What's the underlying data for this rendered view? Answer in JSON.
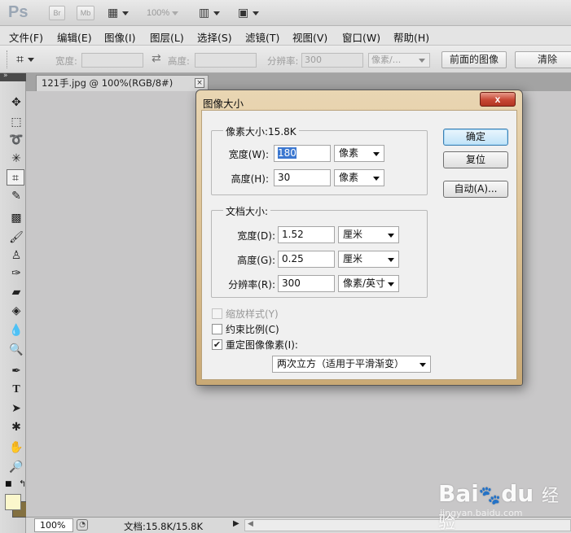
{
  "appbar": {
    "logo": "Ps",
    "bridge": "Br",
    "minibridge": "Mb",
    "zoom": "100%"
  },
  "menubar": {
    "items": [
      "文件(F)",
      "编辑(E)",
      "图像(I)",
      "图层(L)",
      "选择(S)",
      "滤镜(T)",
      "视图(V)",
      "窗口(W)",
      "帮助(H)"
    ]
  },
  "options": {
    "width_label": "宽度:",
    "height_label": "高度:",
    "resolution_label": "分辨率:",
    "resolution_value": "300",
    "resolution_unit": "像素/...",
    "front_image_button": "前面的图像",
    "clear_button": "清除"
  },
  "document": {
    "tab_title": "121手.jpg @ 100%(RGB/8#)",
    "close_glyph": "×"
  },
  "statusbar": {
    "zoom": "100%",
    "doc_info": "文档:15.8K/15.8K"
  },
  "dialog": {
    "title": "图像大小",
    "close_glyph": "x",
    "pixel_dimensions": {
      "legend": "像素大小:15.8K",
      "width_label": "宽度(W):",
      "width_value": "180",
      "width_unit": "像素",
      "height_label": "高度(H):",
      "height_value": "30",
      "height_unit": "像素"
    },
    "document_size": {
      "legend": "文档大小:",
      "width_label": "宽度(D):",
      "width_value": "1.52",
      "width_unit": "厘米",
      "height_label": "高度(G):",
      "height_value": "0.25",
      "height_unit": "厘米",
      "resolution_label": "分辨率(R):",
      "resolution_value": "300",
      "resolution_unit": "像素/英寸"
    },
    "options": {
      "scale_styles": "缩放样式(Y)",
      "scale_styles_checked": false,
      "scale_styles_enabled": false,
      "constrain": "约束比例(C)",
      "constrain_checked": false,
      "resample": "重定图像像素(I):",
      "resample_checked": true,
      "resample_method": "两次立方（适用于平滑渐变）"
    },
    "buttons": {
      "ok": "确定",
      "reset": "复位",
      "auto": "自动(A)..."
    }
  },
  "colors": {
    "foreground": "#fbf7cc",
    "background": "#837040"
  },
  "watermark": {
    "logo": "Bai du 经验",
    "url": "jingyan.baidu.com"
  }
}
